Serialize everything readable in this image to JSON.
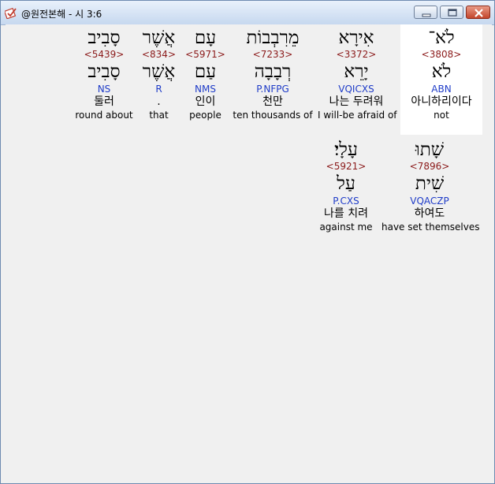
{
  "window": {
    "title": "@원전본해 - 시 3:6",
    "icon": "bible-app-icon",
    "controls": [
      "minimize-icon",
      "maximize-icon",
      "close-icon"
    ]
  },
  "colors": {
    "strong_number": "#8b1a1a",
    "morphology": "#1f3cc8",
    "highlight_bg": "#ffffff"
  },
  "rows": [
    {
      "words": [
        {
          "hebrew": "לֹא־",
          "strong": "<3808>",
          "lemma": "לֹא",
          "morph": "ABN",
          "korean": "아니하리이다",
          "english": "not",
          "highlighted": true
        },
        {
          "hebrew": "אִירָא",
          "strong": "<3372>",
          "lemma": "יָרֵא",
          "morph": "VQICXS",
          "korean": "나는 두려워",
          "english": "I will-be afraid of",
          "highlighted": false
        },
        {
          "hebrew": "מֵרִבְבוֹת",
          "strong": "<7233>",
          "lemma": "רְבָבָה",
          "morph": "P.NFPG",
          "korean": "천만",
          "english": "ten thousands of",
          "highlighted": false
        },
        {
          "hebrew": "עָם",
          "strong": "<5971>",
          "lemma": "עַם",
          "morph": "NMS",
          "korean": "인이",
          "english": "people",
          "highlighted": false
        },
        {
          "hebrew": "אֲשֶׁר",
          "strong": "<834>",
          "lemma": "אֲשֶׁר",
          "morph": "R",
          "korean": ".",
          "english": "that",
          "highlighted": false
        },
        {
          "hebrew": "סָבִיב",
          "strong": "<5439>",
          "lemma": "סָבִיב",
          "morph": "NS",
          "korean": "둘러",
          "english": "round about",
          "highlighted": false
        }
      ]
    },
    {
      "words": [
        {
          "hebrew": "שָׁתוּ",
          "strong": "<7896>",
          "lemma": "שִׁית",
          "morph": "VQACZP",
          "korean": "하여도",
          "english": "have set themselves",
          "highlighted": false
        },
        {
          "hebrew": "עָלָי׃",
          "strong": "<5921>",
          "lemma": "עַל",
          "morph": "P.CXS",
          "korean": "나를 치려",
          "english": "against me",
          "highlighted": false
        }
      ]
    }
  ]
}
